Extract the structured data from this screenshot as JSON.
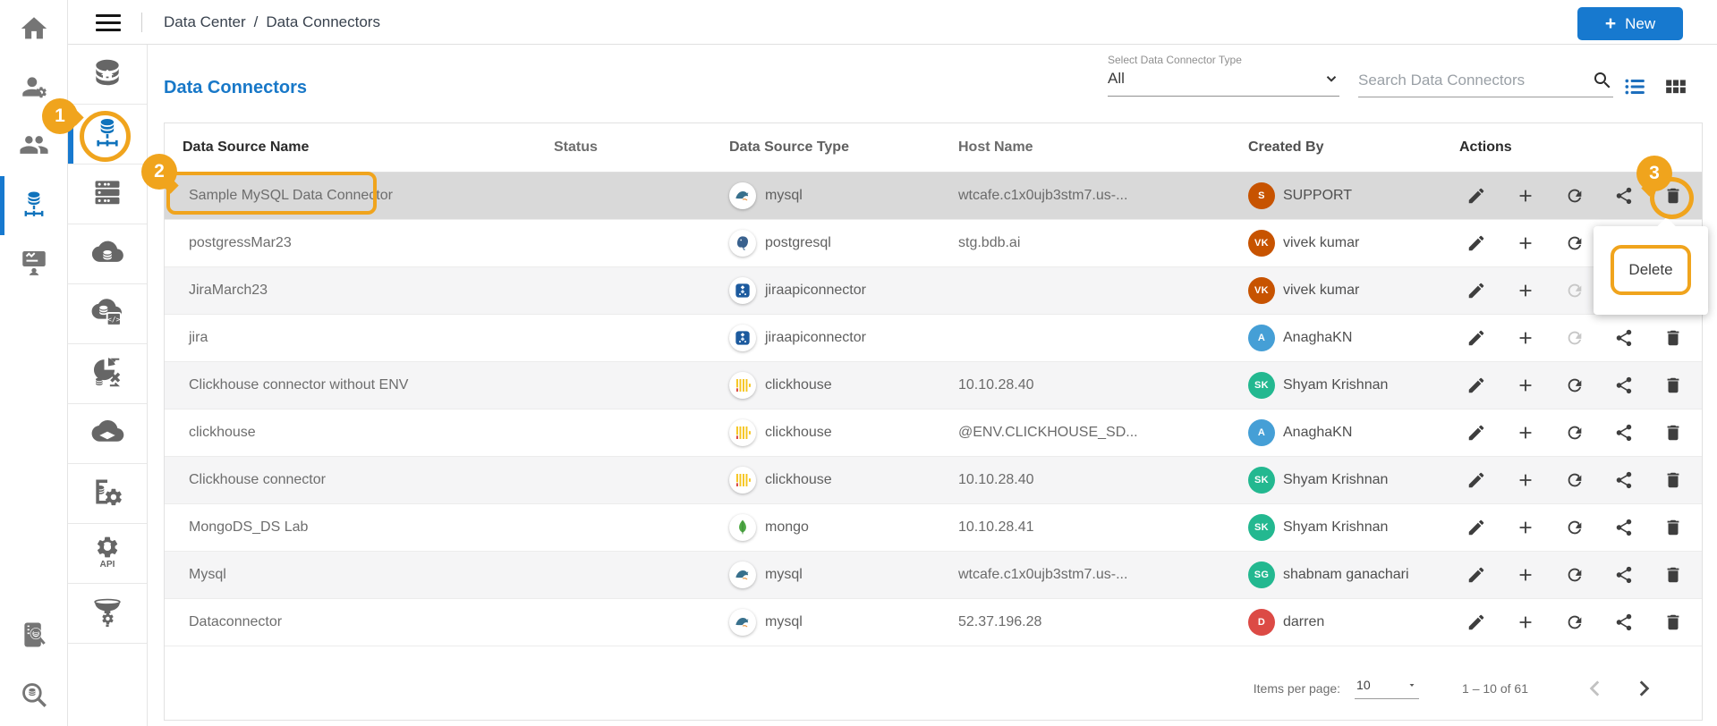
{
  "topbar": {
    "breadcrumb": [
      "Data Center",
      "Data Connectors"
    ],
    "breadcrumb_separator": "/",
    "new_button_label": "New",
    "new_button_plus": "+"
  },
  "sidebar_primary": {
    "items_top": [
      "home",
      "user-settings",
      "user-groups",
      "data-connectors",
      "dashboard-publish"
    ],
    "active_item": "data-connectors",
    "items_bottom": [
      "audit-search",
      "data-search"
    ]
  },
  "sidebar_secondary": {
    "items": [
      "data-center-home",
      "data-connectors",
      "data-stores",
      "data-sets",
      "data-sets-scripts",
      "data-preparation",
      "data-sandbox",
      "data-store-settings",
      "api-connectors",
      "etl-pipeline"
    ],
    "active_item": "data-connectors"
  },
  "page": {
    "title": "Data Connectors"
  },
  "filter": {
    "label": "Select Data Connector Type",
    "value": "All"
  },
  "search": {
    "placeholder": "Search Data Connectors"
  },
  "table": {
    "columns": [
      "Data Source Name",
      "Status",
      "Data Source Type",
      "Host Name",
      "Created By",
      "Actions"
    ],
    "actions": [
      "edit",
      "add",
      "refresh",
      "share",
      "delete"
    ],
    "rows": [
      {
        "name": "Sample MySQL Data Connector",
        "status": "",
        "type": "mysql",
        "host": "wtcafe.c1x0ujb3stm7.us-...",
        "creator_initials": "S",
        "creator": "SUPPORT",
        "avatar_color": "#c75300",
        "selected": true,
        "refresh_disabled": false
      },
      {
        "name": "postgressMar23",
        "status": "",
        "type": "postgresql",
        "host": "stg.bdb.ai",
        "creator_initials": "VK",
        "creator": "vivek kumar",
        "avatar_color": "#c75300",
        "selected": false,
        "refresh_disabled": false
      },
      {
        "name": "JiraMarch23",
        "status": "",
        "type": "jiraapiconnector",
        "host": "",
        "creator_initials": "VK",
        "creator": "vivek kumar",
        "avatar_color": "#c75300",
        "selected": false,
        "refresh_disabled": true
      },
      {
        "name": "jira",
        "status": "",
        "type": "jiraapiconnector",
        "host": "",
        "creator_initials": "A",
        "creator": "AnaghaKN",
        "avatar_color": "#459fd6",
        "selected": false,
        "refresh_disabled": true
      },
      {
        "name": "Clickhouse connector without ENV",
        "status": "",
        "type": "clickhouse",
        "host": "10.10.28.40",
        "creator_initials": "SK",
        "creator": "Shyam Krishnan",
        "avatar_color": "#23b890",
        "selected": false,
        "refresh_disabled": false
      },
      {
        "name": "clickhouse",
        "status": "",
        "type": "clickhouse",
        "host": "@ENV.CLICKHOUSE_SD...",
        "creator_initials": "A",
        "creator": "AnaghaKN",
        "avatar_color": "#459fd6",
        "selected": false,
        "refresh_disabled": false
      },
      {
        "name": "Clickhouse connector",
        "status": "",
        "type": "clickhouse",
        "host": "10.10.28.40",
        "creator_initials": "SK",
        "creator": "Shyam Krishnan",
        "avatar_color": "#23b890",
        "selected": false,
        "refresh_disabled": false
      },
      {
        "name": "MongoDS_DS Lab",
        "status": "",
        "type": "mongo",
        "host": "10.10.28.41",
        "creator_initials": "SK",
        "creator": "Shyam Krishnan",
        "avatar_color": "#23b890",
        "selected": false,
        "refresh_disabled": false
      },
      {
        "name": "Mysql",
        "status": "",
        "type": "mysql",
        "host": "wtcafe.c1x0ujb3stm7.us-...",
        "creator_initials": "SG",
        "creator": "shabnam ganachari",
        "avatar_color": "#23b890",
        "selected": false,
        "refresh_disabled": false
      },
      {
        "name": "Dataconnector",
        "status": "",
        "type": "mysql",
        "host": "52.37.196.28",
        "creator_initials": "D",
        "creator": "darren",
        "avatar_color": "#dc4a45",
        "selected": false,
        "refresh_disabled": false
      }
    ]
  },
  "pagination": {
    "label": "Items per page:",
    "per_page": "10",
    "range": "1 – 10 of 61"
  },
  "popup": {
    "delete_label": "Delete"
  },
  "annotations": {
    "badge1": "1",
    "badge2": "2",
    "badge3": "3",
    "highlight_color": "#f0a41d"
  },
  "colors": {
    "accent_blue": "#1779cf",
    "title_blue": "#1878c8",
    "selected_row": "#d9d9d9",
    "stripe": "#f5f5f6",
    "annotation_orange": "#f0a41d"
  }
}
